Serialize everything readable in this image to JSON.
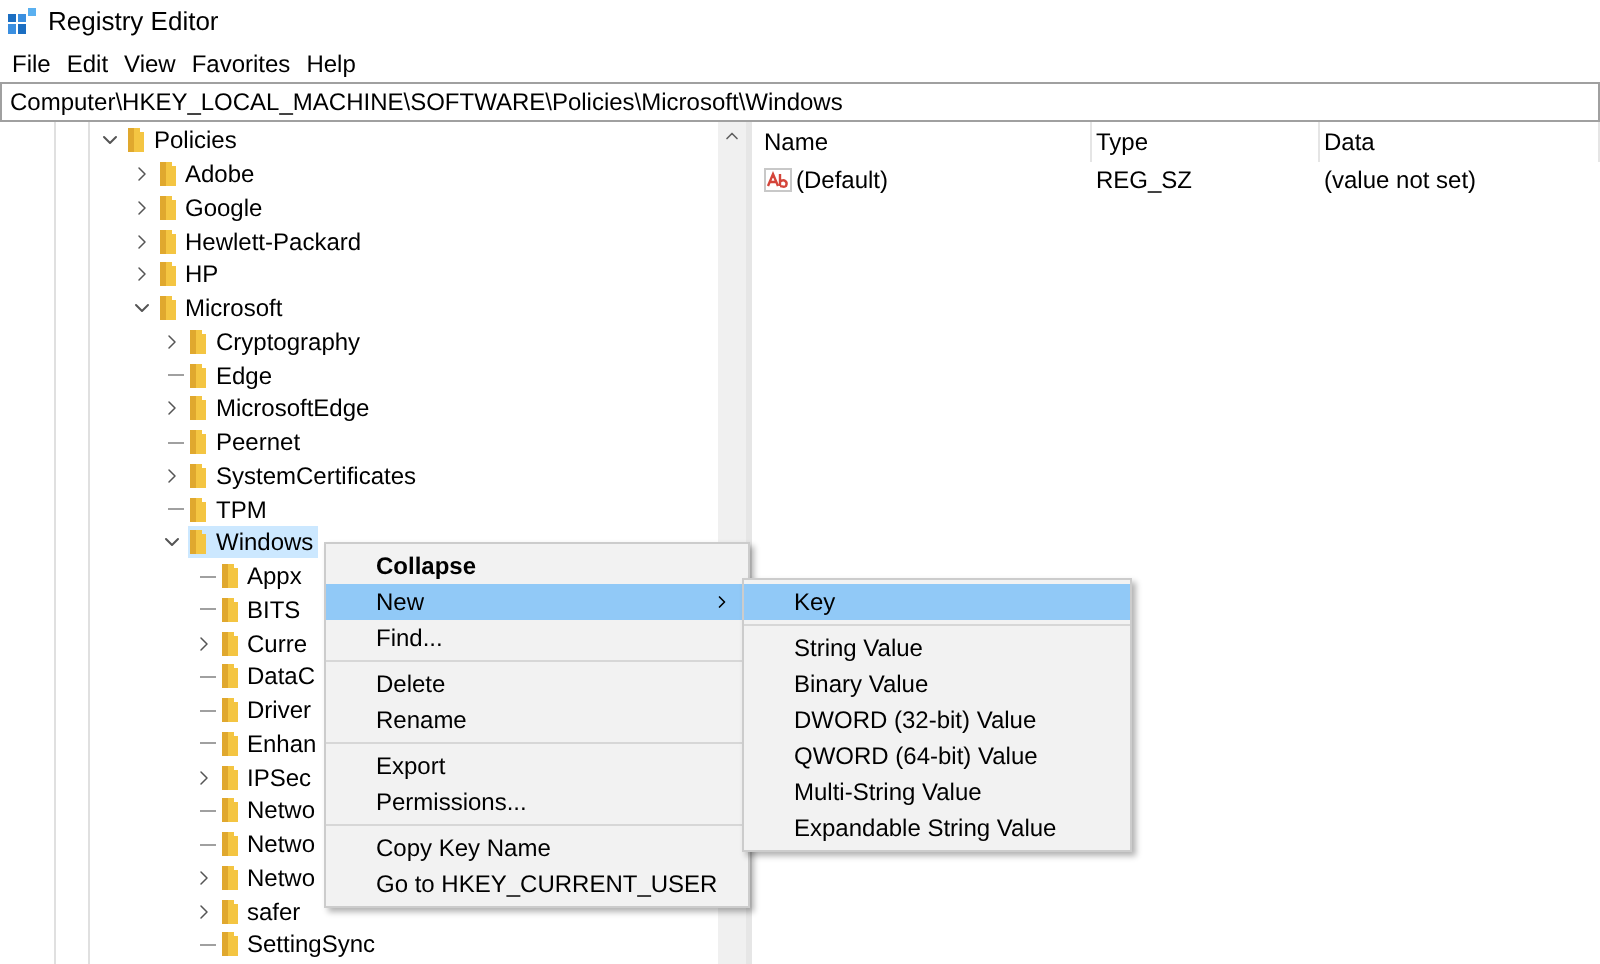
{
  "window": {
    "title": "Registry Editor"
  },
  "menu_bar": [
    "File",
    "Edit",
    "View",
    "Favorites",
    "Help"
  ],
  "address": "Computer\\HKEY_LOCAL_MACHINE\\SOFTWARE\\Policies\\Microsoft\\Windows",
  "tree": [
    {
      "label": "Policies",
      "kind": "branch",
      "expanded": true,
      "selected": false,
      "children": [
        {
          "label": "Adobe",
          "kind": "branch",
          "expanded": false,
          "selected": false
        },
        {
          "label": "Google",
          "kind": "branch",
          "expanded": false,
          "selected": false
        },
        {
          "label": "Hewlett-Packard",
          "kind": "branch",
          "expanded": false,
          "selected": false
        },
        {
          "label": "HP",
          "kind": "branch",
          "expanded": false,
          "selected": false
        },
        {
          "label": "Microsoft",
          "kind": "branch",
          "expanded": true,
          "selected": false,
          "children": [
            {
              "label": "Cryptography",
              "kind": "branch",
              "expanded": false,
              "selected": false
            },
            {
              "label": "Edge",
              "kind": "leaf",
              "expanded": false,
              "selected": false
            },
            {
              "label": "MicrosoftEdge",
              "kind": "branch",
              "expanded": false,
              "selected": false
            },
            {
              "label": "Peernet",
              "kind": "leaf",
              "expanded": false,
              "selected": false
            },
            {
              "label": "SystemCertificates",
              "kind": "branch",
              "expanded": false,
              "selected": false
            },
            {
              "label": "TPM",
              "kind": "leaf",
              "expanded": false,
              "selected": false
            },
            {
              "label": "Windows",
              "kind": "branch",
              "expanded": true,
              "selected": true,
              "children": [
                {
                  "label": "Appx",
                  "kind": "leaf",
                  "expanded": false,
                  "selected": false
                },
                {
                  "label": "BITS",
                  "kind": "leaf",
                  "expanded": false,
                  "selected": false
                },
                {
                  "label": "Curre",
                  "kind": "branch",
                  "expanded": false,
                  "selected": false
                },
                {
                  "label": "DataC",
                  "kind": "leaf",
                  "expanded": false,
                  "selected": false
                },
                {
                  "label": "Driver",
                  "kind": "leaf",
                  "expanded": false,
                  "selected": false
                },
                {
                  "label": "Enhan",
                  "kind": "leaf",
                  "expanded": false,
                  "selected": false
                },
                {
                  "label": "IPSec",
                  "kind": "branch",
                  "expanded": false,
                  "selected": false
                },
                {
                  "label": "Netwo",
                  "kind": "leaf",
                  "expanded": false,
                  "selected": false
                },
                {
                  "label": "Netwo",
                  "kind": "leaf",
                  "expanded": false,
                  "selected": false
                },
                {
                  "label": "Netwo",
                  "kind": "branch",
                  "expanded": false,
                  "selected": false
                },
                {
                  "label": "safer",
                  "kind": "branch",
                  "expanded": false,
                  "selected": false
                },
                {
                  "label": "SettingSync",
                  "kind": "leaf",
                  "expanded": false,
                  "selected": false
                }
              ]
            }
          ]
        }
      ]
    }
  ],
  "values": {
    "columns": [
      "Name",
      "Type",
      "Data"
    ],
    "rows": [
      {
        "name": "(Default)",
        "type": "REG_SZ",
        "data": "(value not set)"
      }
    ]
  },
  "context_menu": {
    "groups": [
      [
        {
          "label": "Collapse",
          "default": true,
          "submenu": false,
          "selected": false
        },
        {
          "label": "New",
          "default": false,
          "submenu": true,
          "selected": true
        },
        {
          "label": "Find...",
          "default": false,
          "submenu": false,
          "selected": false
        }
      ],
      [
        {
          "label": "Delete",
          "default": false,
          "submenu": false,
          "selected": false
        },
        {
          "label": "Rename",
          "default": false,
          "submenu": false,
          "selected": false
        }
      ],
      [
        {
          "label": "Export",
          "default": false,
          "submenu": false,
          "selected": false
        },
        {
          "label": "Permissions...",
          "default": false,
          "submenu": false,
          "selected": false
        }
      ],
      [
        {
          "label": "Copy Key Name",
          "default": false,
          "submenu": false,
          "selected": false
        },
        {
          "label": "Go to HKEY_CURRENT_USER",
          "default": false,
          "submenu": false,
          "selected": false
        }
      ]
    ]
  },
  "submenu": {
    "groups": [
      [
        {
          "label": "Key",
          "default": false,
          "submenu": false,
          "selected": true
        }
      ],
      [
        {
          "label": "String Value",
          "default": false,
          "submenu": false,
          "selected": false
        },
        {
          "label": "Binary Value",
          "default": false,
          "submenu": false,
          "selected": false
        },
        {
          "label": "DWORD (32-bit) Value",
          "default": false,
          "submenu": false,
          "selected": false
        },
        {
          "label": "QWORD (64-bit) Value",
          "default": false,
          "submenu": false,
          "selected": false
        },
        {
          "label": "Multi-String Value",
          "default": false,
          "submenu": false,
          "selected": false
        },
        {
          "label": "Expandable String Value",
          "default": false,
          "submenu": false,
          "selected": false
        }
      ]
    ]
  }
}
